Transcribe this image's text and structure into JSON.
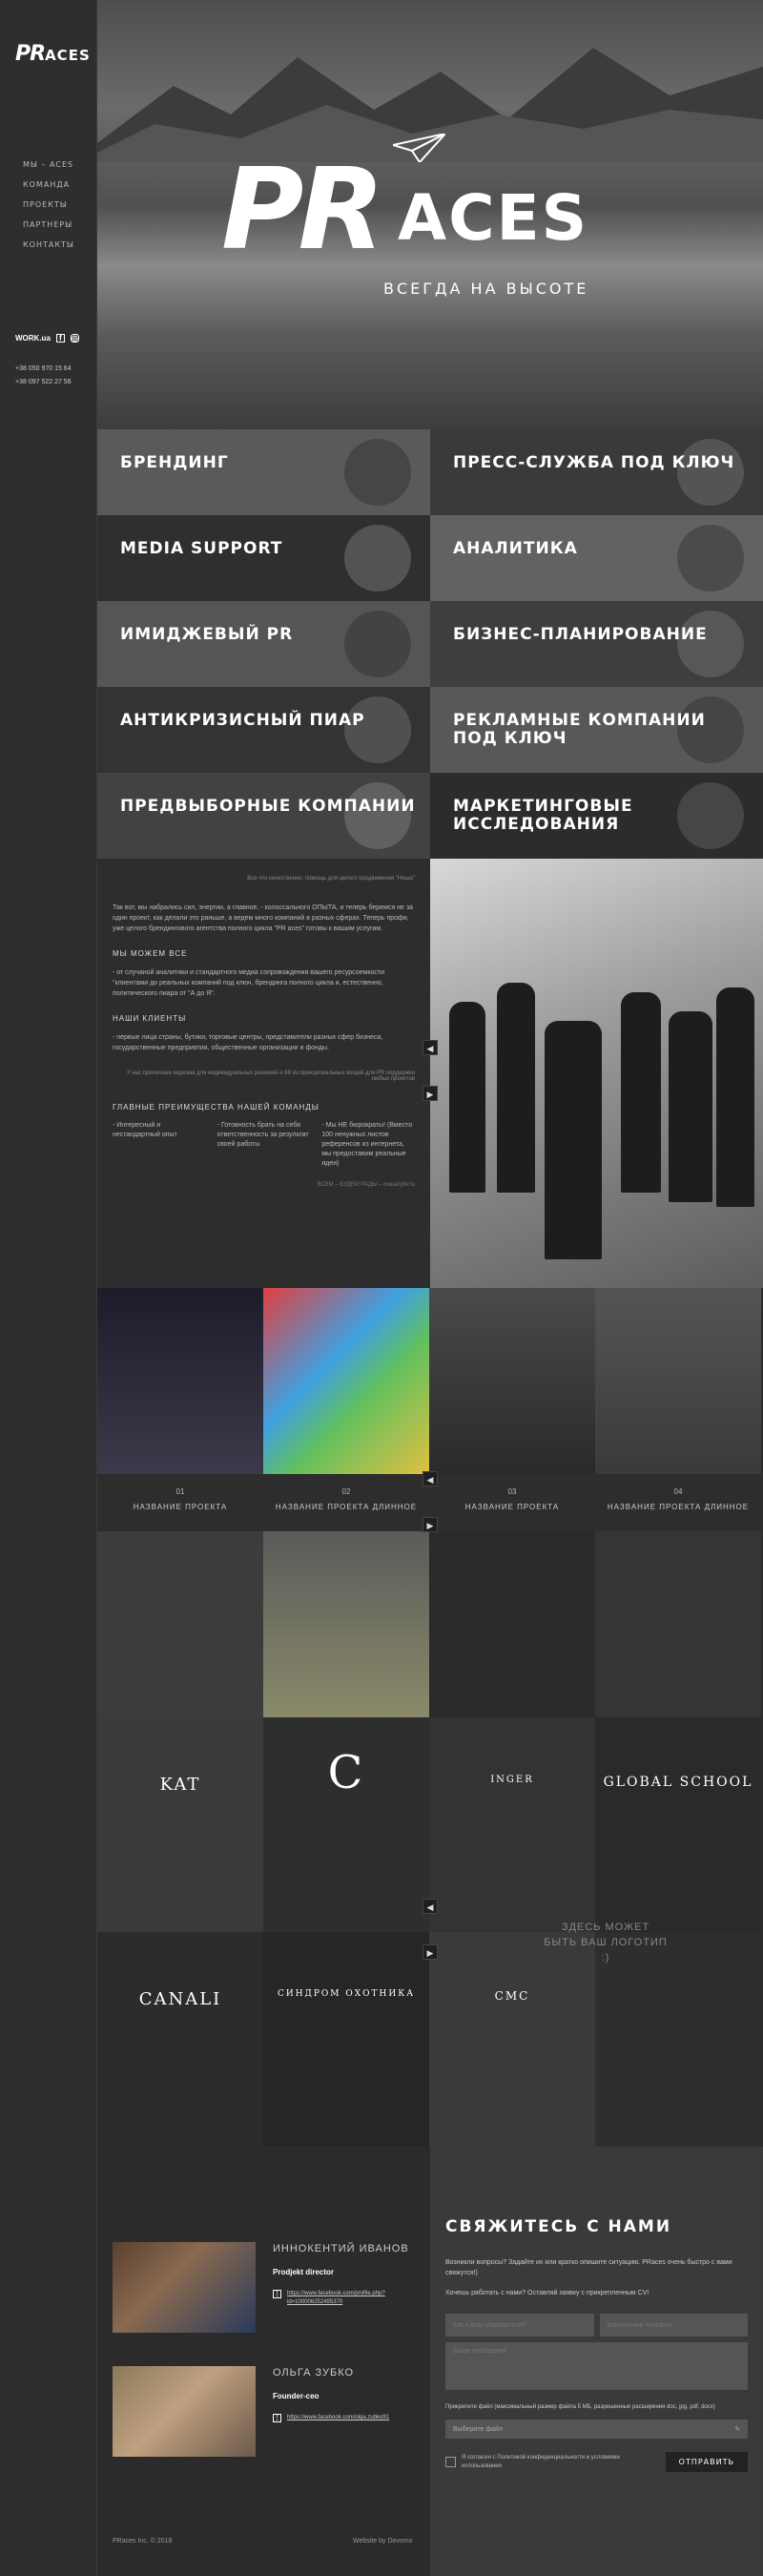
{
  "brand": {
    "logo_pr": "PR",
    "logo_aces": "ACES"
  },
  "nav": [
    "Мы – Aces",
    "Команда",
    "Проекты",
    "Партнеры",
    "Контакты"
  ],
  "social": {
    "work": "WORK.ua"
  },
  "phones": [
    "+38 050 970 15 64",
    "+38 097 522 27 56"
  ],
  "hero": {
    "pr": "PR",
    "aces": "ACES",
    "subtitle": "ВСЕГДА НА ВЫСОТЕ"
  },
  "services": [
    "Брендинг",
    "Пресс-служба под ключ",
    "Media support",
    "Аналитика",
    "Имиджевый PR",
    "Бизнес-планирование",
    "Антикризисный пиар",
    "Рекламные компании под ключ",
    "Предвыборные компании",
    "Маркетинговые исследования"
  ],
  "about": {
    "tag": "Все что качественно, помощь для целого продвижения \"Ниша\"",
    "intro": "Так вот, мы набрались сил, энергии, а главное, - колоссального ОПЫТА, и теперь беремся не за один проект, как делали это раньше, а ведем много компаний в разных сферах. Теперь профи, уже целого брендингового агентства полного цикла \"PR aces\" готовы к вашим услугам.",
    "can_title": "Мы можем все",
    "can_text": "- от случаной аналитики и стандартного медиа сопровождения вашего ресурсоемкости \"клиентами до реальных компаний под ключ, брендинга полного цикла и, естественно, политического пиара от \"А до Я\".",
    "clients_title": "Наши клиенты",
    "clients_text": "- первые лица страны, бутики, торговые центры, представители разных сфер бизнеса, государственные предприятия, общественные организации и фонды.",
    "quote": "У нас приличная харизма для индивидуальных решений и 89 из принципиальных вещей для PR поддержки любых проектов",
    "adv_title": "Главные преимущества нашей команды",
    "adv": [
      "- Интересный и нестандартный опыт",
      "- Готовность брать на себя ответственность за результат своей работы",
      "- Мы НЕ бюрократы! (Вместо 100 ненужных листов референсов из интернета, мы предоставим реальные идеи)"
    ],
    "note": "ВСЕМ – БУДЕМ РАДЫ – пожалуйста"
  },
  "projects": [
    {
      "num": "01",
      "name": "Название проекта"
    },
    {
      "num": "02",
      "name": "Название проекта длинное"
    },
    {
      "num": "03",
      "name": "Название проекта"
    },
    {
      "num": "04",
      "name": "Название проекта длинное"
    }
  ],
  "clients": {
    "logos": [
      "KAT",
      "C",
      "INGER",
      "GLOBAL SCHOOL",
      "CANALI",
      "СИНДРОМ ОХОТНИКА",
      "CMC",
      ""
    ],
    "placeholder": "Здесь может быть ваш логотип :)"
  },
  "team": [
    {
      "name": "Иннокентий Иванов",
      "role": "Prodjekt director",
      "fb": "https://www.facebook.com/profile.php?id=100006252495370"
    },
    {
      "name": "Ольга Зубко",
      "role": "Founder-ceo",
      "fb": "https://www.facebook.com/olga.zubko91"
    }
  ],
  "form": {
    "title": "Свяжитесь с нами",
    "lead": "Возникли вопросы? Задайте их или кратко опишите ситуацию. PRaces очень быстро с вами свяжутся!)",
    "job": "Хочешь работать с нами? Оставляй заявку с прикрепленным CV!",
    "name_ph": "Как к Вам обращаться?",
    "phone_ph": "Контактный телефон",
    "msg_ph": "Ваше сообщение",
    "upload": "Прикрепите файл (максимальный размер файла 5 МБ, разрешенные расширения doc, jpg, pdf, docx)",
    "file_ph": "Выберите файл",
    "agree": "Я согласен с Политикой конфиденциальности и условиями использования",
    "send": "Отправить"
  },
  "footer": {
    "copy": "PRaces Inc. © 2018",
    "dev": "Website by Devomo"
  }
}
